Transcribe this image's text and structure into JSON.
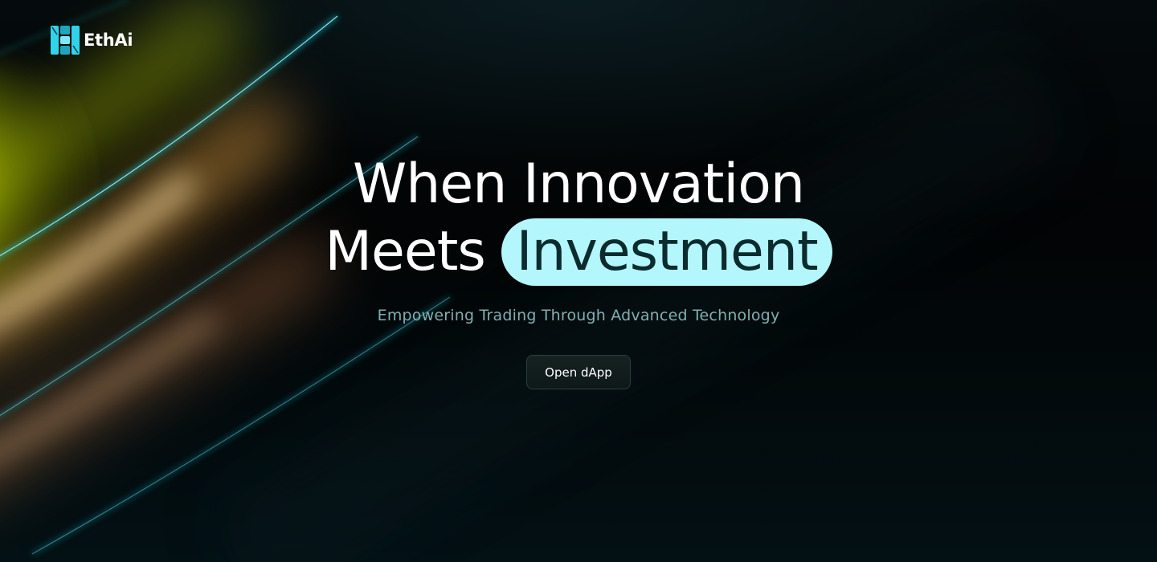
{
  "brand": {
    "name": "EthAi",
    "logo_icon": "ethai-logo-icon",
    "accent_color": "#b3f6fb"
  },
  "hero": {
    "headline_line1": "When Innovation",
    "headline_line2_prefix": "Meets",
    "headline_highlight": "Investment",
    "subtitle": "Empowering Trading Through Advanced Technology",
    "cta_label": "Open dApp"
  }
}
